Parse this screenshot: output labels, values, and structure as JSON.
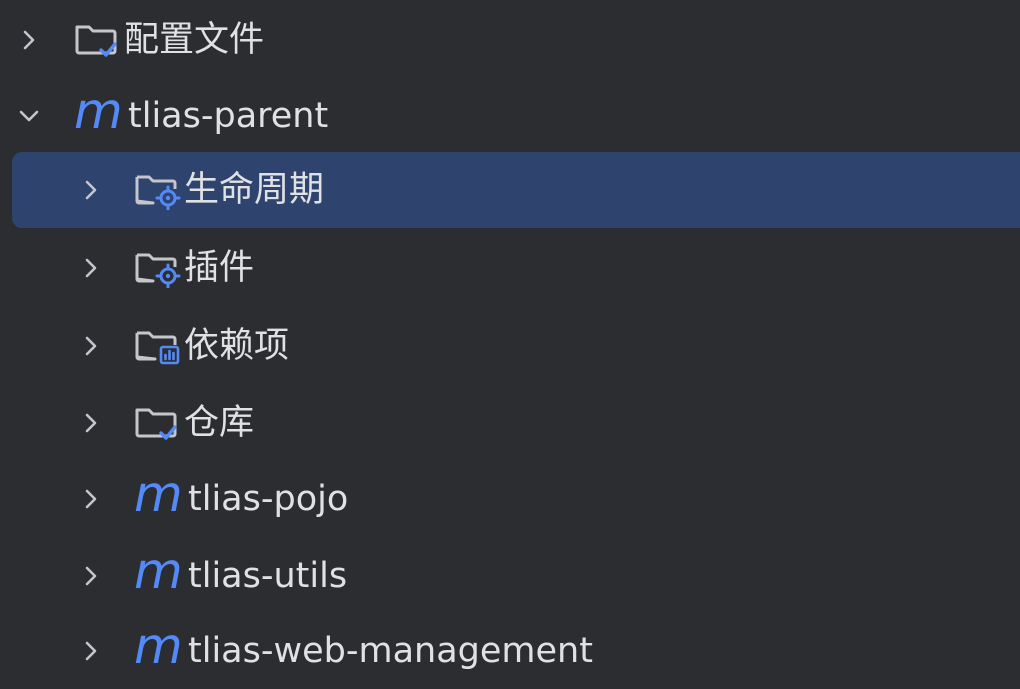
{
  "tree": {
    "items": [
      {
        "label": "配置文件",
        "icon": "folder-check-icon",
        "expanded": false
      },
      {
        "label": "tlias-parent",
        "icon": "maven-module-icon",
        "expanded": true
      },
      {
        "label": "生命周期",
        "icon": "folder-gear-icon",
        "expanded": false,
        "selected": true
      },
      {
        "label": "插件",
        "icon": "folder-gear-icon",
        "expanded": false
      },
      {
        "label": "依赖项",
        "icon": "folder-chart-icon",
        "expanded": false
      },
      {
        "label": "仓库",
        "icon": "folder-check-icon",
        "expanded": false
      },
      {
        "label": "tlias-pojo",
        "icon": "maven-module-icon",
        "expanded": false
      },
      {
        "label": "tlias-utils",
        "icon": "maven-module-icon",
        "expanded": false
      },
      {
        "label": "tlias-web-management",
        "icon": "maven-module-icon",
        "expanded": false
      }
    ],
    "maven_glyph": "m"
  },
  "colors": {
    "background": "#2b2d30",
    "selection": "#2e436e",
    "accent": "#548af7",
    "text": "#dfe1e5"
  }
}
